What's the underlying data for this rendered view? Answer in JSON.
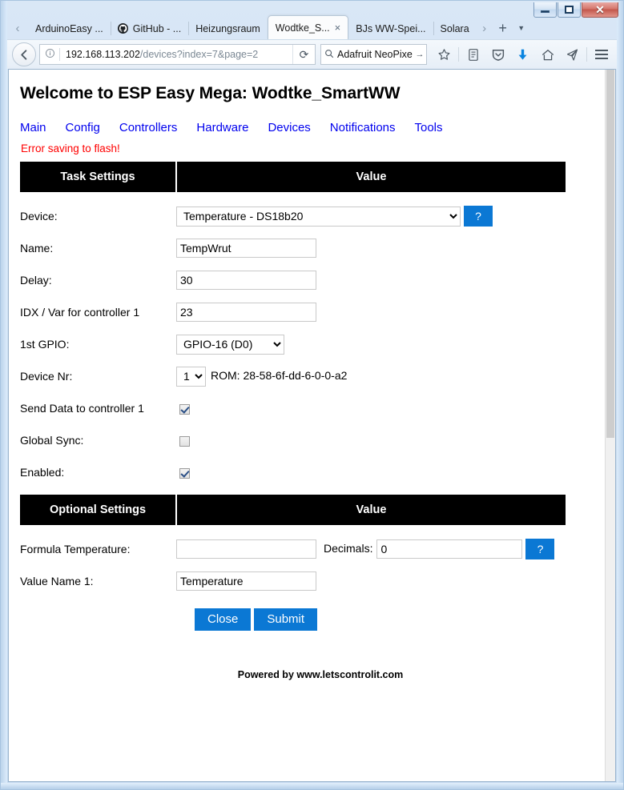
{
  "window": {
    "controls": {
      "minimize_label": "Minimize",
      "maximize_label": "Maximize",
      "close_label": "✕"
    }
  },
  "browser": {
    "tabs": [
      {
        "label": "ArduinoEasy ...",
        "favicon": "none",
        "active": false,
        "closable": false
      },
      {
        "label": "GitHub - ...",
        "favicon": "github-icon",
        "active": false,
        "closable": false
      },
      {
        "label": "Heizungsraum",
        "favicon": "none",
        "active": false,
        "closable": false
      },
      {
        "label": "Wodtke_S...",
        "favicon": "none",
        "active": true,
        "closable": true
      },
      {
        "label": "BJs WW-Spei...",
        "favicon": "none",
        "active": false,
        "closable": false
      },
      {
        "label": "Solara",
        "favicon": "none",
        "active": false,
        "closable": false
      }
    ],
    "tab_close_glyph": "×",
    "scroll_left_glyph": "‹",
    "scroll_right_glyph": "›",
    "new_tab_glyph": "+",
    "tab_list_glyph": "▼",
    "back_glyph": "←",
    "info_glyph": "ⓘ",
    "url": {
      "host": "192.168.113.202",
      "path": "/devices?index=7&page=2"
    },
    "reload_glyph": "⟳",
    "search": {
      "engine_icon": "search-icon",
      "value": "Adafruit NeoPixe",
      "go_glyph": "→"
    },
    "toolbar_icons": [
      "bookmark-star-icon",
      "library-icon",
      "pocket-shield-icon",
      "downloads-icon",
      "home-icon",
      "send-tab-icon",
      "menu-hamburger-icon"
    ],
    "accent_download_color": "#0a84e0"
  },
  "page": {
    "title": "Welcome to ESP Easy Mega: Wodtke_SmartWW",
    "nav": [
      {
        "label": "Main"
      },
      {
        "label": "Config"
      },
      {
        "label": "Controllers"
      },
      {
        "label": "Hardware"
      },
      {
        "label": "Devices"
      },
      {
        "label": "Notifications"
      },
      {
        "label": "Tools"
      }
    ],
    "error_message": "Error saving to flash!",
    "task_settings": {
      "header_left": "Task Settings",
      "header_right": "Value",
      "device": {
        "label": "Device:",
        "value": "Temperature - DS18b20",
        "help_label": "?"
      },
      "name": {
        "label": "Name:",
        "value": "TempWrut"
      },
      "delay": {
        "label": "Delay:",
        "value": "30"
      },
      "idx": {
        "label": "IDX / Var for controller 1",
        "value": "23"
      },
      "gpio": {
        "label": "1st GPIO:",
        "value": "GPIO-16 (D0)"
      },
      "device_nr": {
        "label": "Device Nr:",
        "value": "1",
        "rom": "ROM: 28-58-6f-dd-6-0-0-a2"
      },
      "send_data": {
        "label": "Send Data to controller 1",
        "checked": true
      },
      "global_sync": {
        "label": "Global Sync:",
        "checked": false
      },
      "enabled": {
        "label": "Enabled:",
        "checked": true
      }
    },
    "optional_settings": {
      "header_left": "Optional Settings",
      "header_right": "Value",
      "formula": {
        "label": "Formula Temperature:",
        "value": "",
        "decimals_label": "Decimals:",
        "decimals_value": "0",
        "help_label": "?"
      },
      "value_name_1": {
        "label": "Value Name 1:",
        "value": "Temperature"
      }
    },
    "buttons": {
      "close": "Close",
      "submit": "Submit"
    },
    "footer": "Powered by www.letscontrolit.com",
    "colors": {
      "link": "#0000ee",
      "error": "#ff0000",
      "header_bg": "#000000",
      "button_blue": "#0b78d4"
    }
  }
}
